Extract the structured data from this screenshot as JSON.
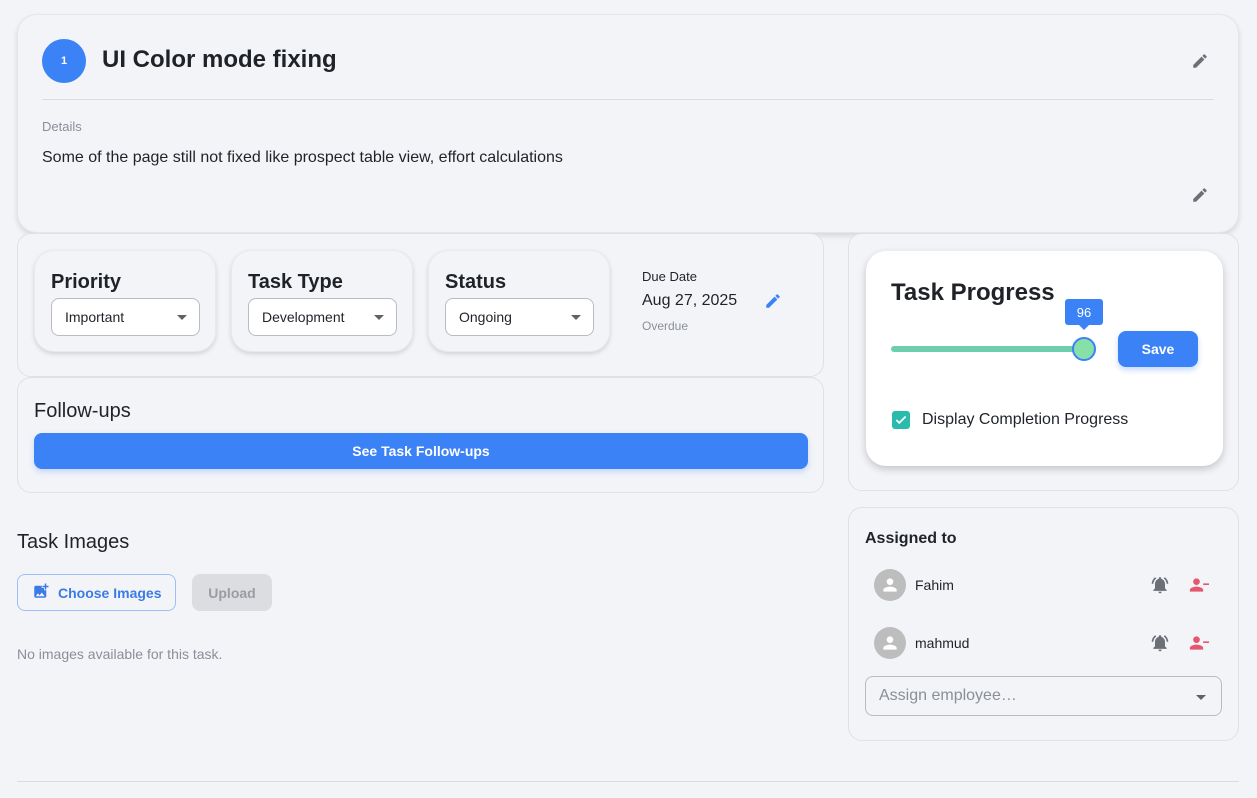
{
  "task": {
    "number": "1",
    "title": "UI Color mode fixing",
    "details_label": "Details",
    "details_text": "Some of the page still not fixed like prospect table view, effort calculations"
  },
  "meta": {
    "priority": {
      "label": "Priority",
      "value": "Important"
    },
    "task_type": {
      "label": "Task Type",
      "value": "Development"
    },
    "status": {
      "label": "Status",
      "value": "Ongoing"
    },
    "due_date": {
      "label": "Due Date",
      "value": "Aug 27, 2025",
      "status": "Overdue"
    }
  },
  "followups": {
    "title": "Follow-ups",
    "button_label": "See Task Follow-ups"
  },
  "images": {
    "title": "Task Images",
    "choose_label": "Choose Images",
    "upload_label": "Upload",
    "empty_text": "No images available for this task."
  },
  "progress": {
    "title": "Task Progress",
    "value": 96,
    "value_label": "96",
    "save_label": "Save",
    "display_completion_label": "Display Completion Progress",
    "display_completion_checked": true
  },
  "assigned": {
    "title": "Assigned to",
    "employees": [
      {
        "name": "Fahim"
      },
      {
        "name": "mahmud"
      }
    ],
    "assign_placeholder": "Assign employee…"
  },
  "colors": {
    "accent": "#3b82f6",
    "slider_fill": "#6ccfae",
    "checkbox": "#2bbbad",
    "remove_icon": "#e5566f"
  },
  "icons": [
    "edit-icon",
    "image-add-icon",
    "bell-icon",
    "person-remove-icon",
    "person-icon",
    "check-icon",
    "chevron-down-icon"
  ]
}
